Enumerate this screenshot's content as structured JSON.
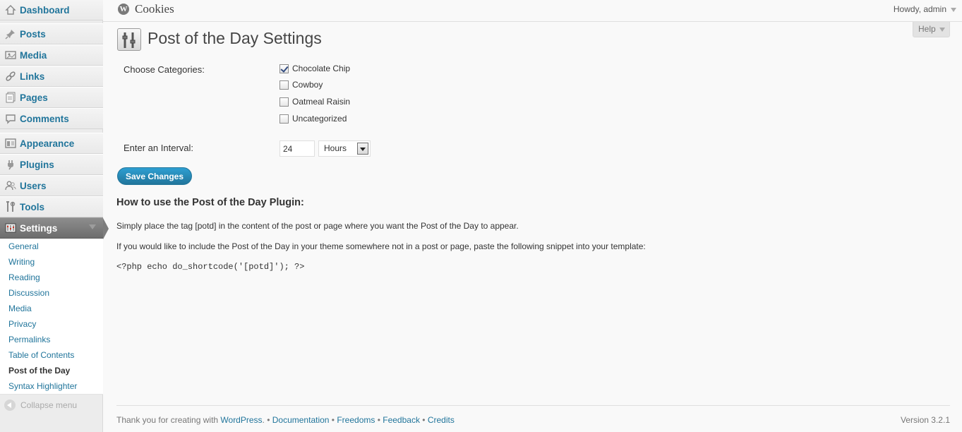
{
  "sidebar": {
    "menu": [
      {
        "label": "Dashboard",
        "icon": "dashboard-icon"
      },
      {
        "label": "Posts",
        "icon": "pin-icon"
      },
      {
        "label": "Media",
        "icon": "media-icon"
      },
      {
        "label": "Links",
        "icon": "link-icon"
      },
      {
        "label": "Pages",
        "icon": "pages-icon"
      },
      {
        "label": "Comments",
        "icon": "comment-icon"
      },
      {
        "label": "Appearance",
        "icon": "appearance-icon"
      },
      {
        "label": "Plugins",
        "icon": "plug-icon"
      },
      {
        "label": "Users",
        "icon": "users-icon"
      },
      {
        "label": "Tools",
        "icon": "tools-icon"
      },
      {
        "label": "Settings",
        "icon": "settings-icon"
      }
    ],
    "submenu": [
      {
        "label": "General"
      },
      {
        "label": "Writing"
      },
      {
        "label": "Reading"
      },
      {
        "label": "Discussion"
      },
      {
        "label": "Media"
      },
      {
        "label": "Privacy"
      },
      {
        "label": "Permalinks"
      },
      {
        "label": "Table of Contents"
      },
      {
        "label": "Post of the Day"
      },
      {
        "label": "Syntax Highlighter"
      }
    ],
    "collapse_label": "Collapse menu"
  },
  "header": {
    "site_logo_letter": "W",
    "site_title": "Cookies",
    "howdy": "Howdy, admin",
    "help": "Help"
  },
  "page": {
    "title": "Post of the Day Settings",
    "categories_label": "Choose Categories:",
    "categories": [
      {
        "label": "Chocolate Chip",
        "checked": true
      },
      {
        "label": "Cowboy",
        "checked": false
      },
      {
        "label": "Oatmeal Raisin",
        "checked": false
      },
      {
        "label": "Uncategorized",
        "checked": false
      }
    ],
    "interval_label": "Enter an Interval:",
    "interval_value": "24",
    "interval_unit": "Hours",
    "save_label": "Save Changes",
    "howto_title": "How to use the Post of the Day Plugin:",
    "howto_p1": "Simply place the tag [potd] in the content of the post or page where you want the Post of the Day to appear.",
    "howto_p2": "If you would like to include the Post of the Day in your theme somewhere not in a post or page, paste the following snippet into your template:",
    "code": "<?php echo do_shortcode('[potd]'); ?>"
  },
  "footer": {
    "thanks_prefix": "Thank you for creating with ",
    "wordpress_link": "WordPress",
    "links": [
      "Documentation",
      "Freedoms",
      "Feedback",
      "Credits"
    ],
    "version": "Version 3.2.1"
  },
  "colors": {
    "link": "#21759b",
    "active_menu": "#7d7d7d",
    "button": "#21759b"
  }
}
